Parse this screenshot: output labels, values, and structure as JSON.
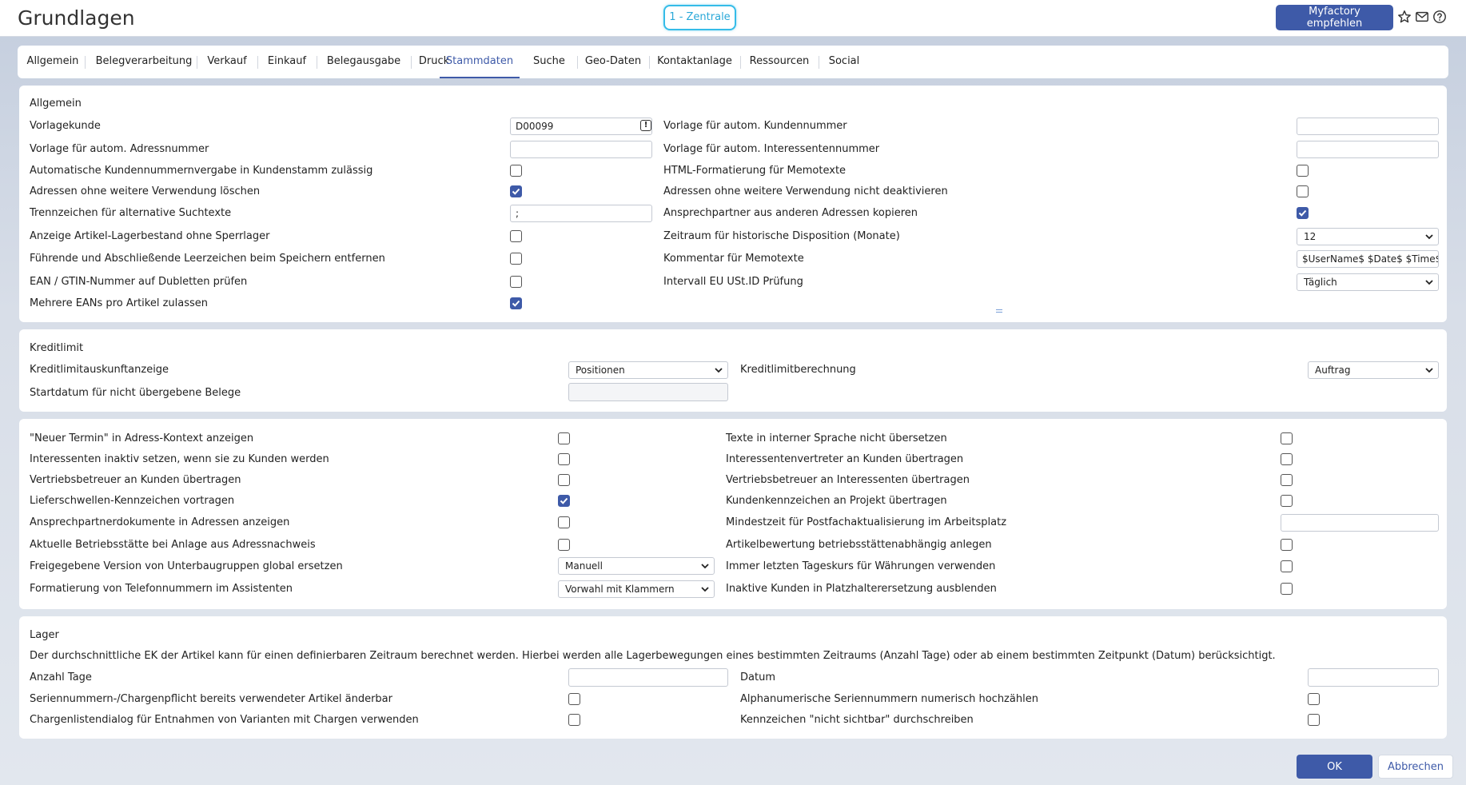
{
  "header": {
    "title": "Grundlagen",
    "branch": "1 - Zentrale",
    "recommend_label": "Myfactory empfehlen",
    "icons": [
      "star-icon",
      "mail-icon",
      "help-icon"
    ]
  },
  "tabs": [
    {
      "label": "Allgemein"
    },
    {
      "label": "Belegverarbeitung"
    },
    {
      "label": "Verkauf"
    },
    {
      "label": "Einkauf"
    },
    {
      "label": "Belegausgabe"
    },
    {
      "label": "Druck"
    },
    {
      "label": "Stammdaten",
      "active": true
    },
    {
      "label": "Suche"
    },
    {
      "label": "Geo-Daten"
    },
    {
      "label": "Kontaktanlage"
    },
    {
      "label": "Ressourcen"
    },
    {
      "label": "Social"
    }
  ],
  "allgemein": {
    "title": "Allgemein",
    "vorlagekunde_label": "Vorlagekunde",
    "vorlagekunde_value": "D00099",
    "adressnr_label": "Vorlage für autom. Adressnummer",
    "adressnr_value": "",
    "auto_kundennr_label": "Automatische Kundennummernvergabe in Kundenstamm zulässig",
    "auto_kundennr_checked": false,
    "adr_loeschen_label": "Adressen ohne weitere Verwendung löschen",
    "adr_loeschen_checked": true,
    "trennzeichen_label": "Trennzeichen für alternative Suchtexte",
    "trennzeichen_value": ";",
    "lagerbestand_label": "Anzeige Artikel-Lagerbestand ohne Sperrlager",
    "lagerbestand_checked": false,
    "leerzeichen_label": "Führende und Abschließende Leerzeichen beim Speichern entfernen",
    "leerzeichen_checked": false,
    "ean_label": "EAN / GTIN-Nummer auf Dubletten prüfen",
    "ean_checked": false,
    "mehrere_ean_label": "Mehrere EANs pro Artikel zulassen",
    "mehrere_ean_checked": true,
    "kundennr_label": "Vorlage für autom. Kundennummer",
    "kundennr_value": "",
    "interessentennr_label": "Vorlage für autom. Interessentennummer",
    "interessentennr_value": "",
    "html_memo_label": "HTML-Formatierung für Memotexte",
    "html_memo_checked": false,
    "adr_deaktivieren_label": "Adressen ohne weitere Verwendung nicht deaktivieren",
    "adr_deaktivieren_checked": false,
    "ansprechpartner_label": "Ansprechpartner aus anderen Adressen kopieren",
    "ansprechpartner_checked": true,
    "zeitraum_label": "Zeitraum für historische Disposition (Monate)",
    "zeitraum_value": "12",
    "kommentar_label": "Kommentar für Memotexte",
    "kommentar_value": "$UserName$ $Date$ $Time$:",
    "intervall_label": "Intervall EU USt.ID Prüfung",
    "intervall_value": "Täglich"
  },
  "kreditlimit": {
    "title": "Kreditlimit",
    "anzeige_label": "Kreditlimitauskunftanzeige",
    "anzeige_value": "Positionen",
    "startdatum_label": "Startdatum für nicht übergebene Belege",
    "startdatum_value": "",
    "berechnung_label": "Kreditlimitberechnung",
    "berechnung_value": "Auftrag"
  },
  "optionen": {
    "left": [
      {
        "label": "\"Neuer Termin\" in Adress-Kontext anzeigen",
        "type": "cb",
        "checked": false
      },
      {
        "label": "Interessenten inaktiv setzen, wenn sie zu Kunden werden",
        "type": "cb",
        "checked": false
      },
      {
        "label": "Vertriebsbetreuer an Kunden übertragen",
        "type": "cb",
        "checked": false
      },
      {
        "label": "Lieferschwellen-Kennzeichen vortragen",
        "type": "cb",
        "checked": true
      },
      {
        "label": "Ansprechpartnerdokumente in Adressen anzeigen",
        "type": "cb",
        "checked": false
      },
      {
        "label": "Aktuelle Betriebsstätte bei Anlage aus Adressnachweis",
        "type": "cb",
        "checked": false
      },
      {
        "label": "Freigegebene Version von Unterbaugruppen global ersetzen",
        "type": "sel",
        "value": "Manuell"
      },
      {
        "label": "Formatierung von Telefonnummern im Assistenten",
        "type": "sel",
        "value": "Vorwahl mit Klammern"
      }
    ],
    "right": [
      {
        "label": "Texte in interner Sprache nicht übersetzen",
        "type": "cb",
        "checked": false
      },
      {
        "label": "Interessentenvertreter an Kunden übertragen",
        "type": "cb",
        "checked": false
      },
      {
        "label": "Vertriebsbetreuer an Interessenten übertragen",
        "type": "cb",
        "checked": false
      },
      {
        "label": "Kundenkennzeichen an Projekt übertragen",
        "type": "cb",
        "checked": false
      },
      {
        "label": "Mindestzeit für Postfachaktualisierung im Arbeitsplatz",
        "type": "txt",
        "value": ""
      },
      {
        "label": "Artikelbewertung betriebsstättenabhängig anlegen",
        "type": "cb",
        "checked": false
      },
      {
        "label": "Immer letzten Tageskurs für Währungen verwenden",
        "type": "cb",
        "checked": false
      },
      {
        "label": "Inaktive Kunden in Platzhalterersetzung ausblenden",
        "type": "cb",
        "checked": false
      }
    ]
  },
  "lager": {
    "title": "Lager",
    "info": "Der durchschnittliche EK der Artikel kann für einen definierbaren Zeitraum berechnet werden. Hierbei werden alle Lagerbewegungen eines bestimmten Zeitraums (Anzahl Tage) oder ab einem bestimmten Zeitpunkt (Datum) berücksichtigt.",
    "anzahl_tage_label": "Anzahl Tage",
    "anzahl_tage_value": "",
    "seriennr_label": "Seriennummern-/Chargenpflicht bereits verwendeter Artikel änderbar",
    "seriennr_checked": false,
    "chargen_label": "Chargenlistendialog für Entnahmen von Varianten mit Chargen verwenden",
    "chargen_checked": false,
    "datum_label": "Datum",
    "datum_value": "",
    "alphanum_label": "Alphanumerische Seriennummern numerisch hochzählen",
    "alphanum_checked": false,
    "nicht_sichtbar_label": "Kennzeichen \"nicht sichtbar\" durchschreiben",
    "nicht_sichtbar_checked": false
  },
  "footer": {
    "ok_label": "OK",
    "cancel_label": "Abbrechen"
  },
  "colors": {
    "accent": "#3e5aa8",
    "branch": "#35bce8"
  }
}
